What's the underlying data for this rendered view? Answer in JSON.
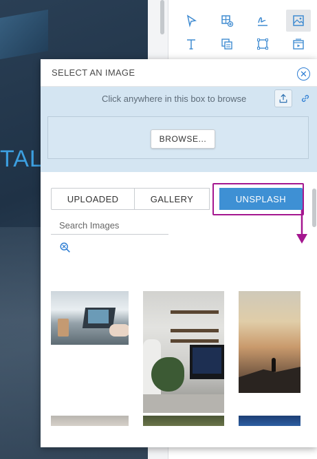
{
  "canvas": {
    "partial_heading": "TAL"
  },
  "modal": {
    "title": "SELECT AN IMAGE",
    "close_icon": "close-icon",
    "upload_zone": {
      "hint": "Click anywhere in this box to browse",
      "upload_icon": "upload-icon",
      "link_icon": "link-icon",
      "browse_label": "BROWSE..."
    },
    "tabs": [
      {
        "label": "UPLOADED",
        "active": false
      },
      {
        "label": "GALLERY",
        "active": false
      },
      {
        "label": "UNSPLASH",
        "active": true
      }
    ],
    "search": {
      "placeholder": "Search Images",
      "value": ""
    },
    "zoom_icon": "zoom-icon"
  },
  "toolbar": {
    "icons": [
      "pointer-icon",
      "add-table-icon",
      "signature-icon",
      "image-icon",
      "text-icon",
      "copy-format-icon",
      "crop-frame-icon",
      "media-icon"
    ],
    "active": "image-icon"
  },
  "colors": {
    "accent": "#3e90d4",
    "upload_zone_bg": "#d4e5f2",
    "annotation": "#a4168f",
    "close_icon": "#2b7cd3"
  }
}
